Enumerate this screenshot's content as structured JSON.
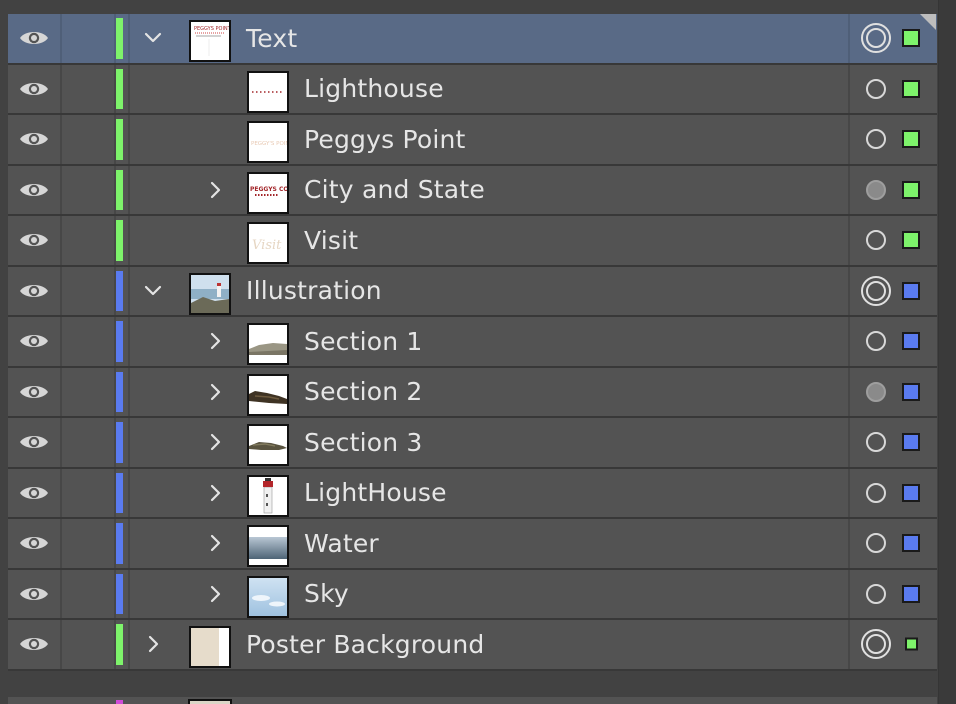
{
  "panel": {
    "name": "Layers panel",
    "colors": {
      "green": "#7ef36b",
      "blue": "#5a7bf0",
      "selected_row": "#596a86",
      "row": "#535353",
      "magenta": "#d04bd8"
    }
  },
  "rows": [
    {
      "label": "Text",
      "level": 0,
      "chevron": "down",
      "selected": true,
      "color": "green",
      "target": "double",
      "thumb": "text"
    },
    {
      "label": "Lighthouse",
      "level": 1,
      "chevron": "none",
      "color": "green",
      "target": "small",
      "thumb": "lighthouse-text"
    },
    {
      "label": "Peggys Point",
      "level": 1,
      "chevron": "none",
      "color": "green",
      "target": "small",
      "thumb": "peggys"
    },
    {
      "label": "City and State",
      "level": 1,
      "chevron": "right",
      "color": "green",
      "target": "filled",
      "thumb": "city"
    },
    {
      "label": "Visit",
      "level": 1,
      "chevron": "none",
      "color": "green",
      "target": "small",
      "thumb": "visit"
    },
    {
      "label": "Illustration",
      "level": 0,
      "chevron": "down",
      "color": "blue",
      "target": "double",
      "thumb": "illustration"
    },
    {
      "label": "Section 1",
      "level": 1,
      "chevron": "right",
      "color": "blue",
      "target": "small",
      "thumb": "section1"
    },
    {
      "label": "Section 2",
      "level": 1,
      "chevron": "right",
      "color": "blue",
      "target": "filled",
      "thumb": "section2"
    },
    {
      "label": "Section 3",
      "level": 1,
      "chevron": "right",
      "color": "blue",
      "target": "small",
      "thumb": "section3"
    },
    {
      "label": "LightHouse",
      "level": 1,
      "chevron": "right",
      "color": "blue",
      "target": "small",
      "thumb": "lighthouse"
    },
    {
      "label": "Water",
      "level": 1,
      "chevron": "right",
      "color": "blue",
      "target": "small",
      "thumb": "water"
    },
    {
      "label": "Sky",
      "level": 1,
      "chevron": "right",
      "color": "blue",
      "target": "small",
      "thumb": "sky"
    },
    {
      "label": "Poster Background",
      "level": 0,
      "chevron": "right",
      "color": "green",
      "target": "double",
      "thumb": "poster",
      "tiny_square": true
    }
  ],
  "icons": {
    "visibility": "eye-icon",
    "expand": "chevron-right-icon",
    "collapse": "chevron-down-icon",
    "target": "target-circle-icon",
    "selection": "selection-square-icon"
  }
}
